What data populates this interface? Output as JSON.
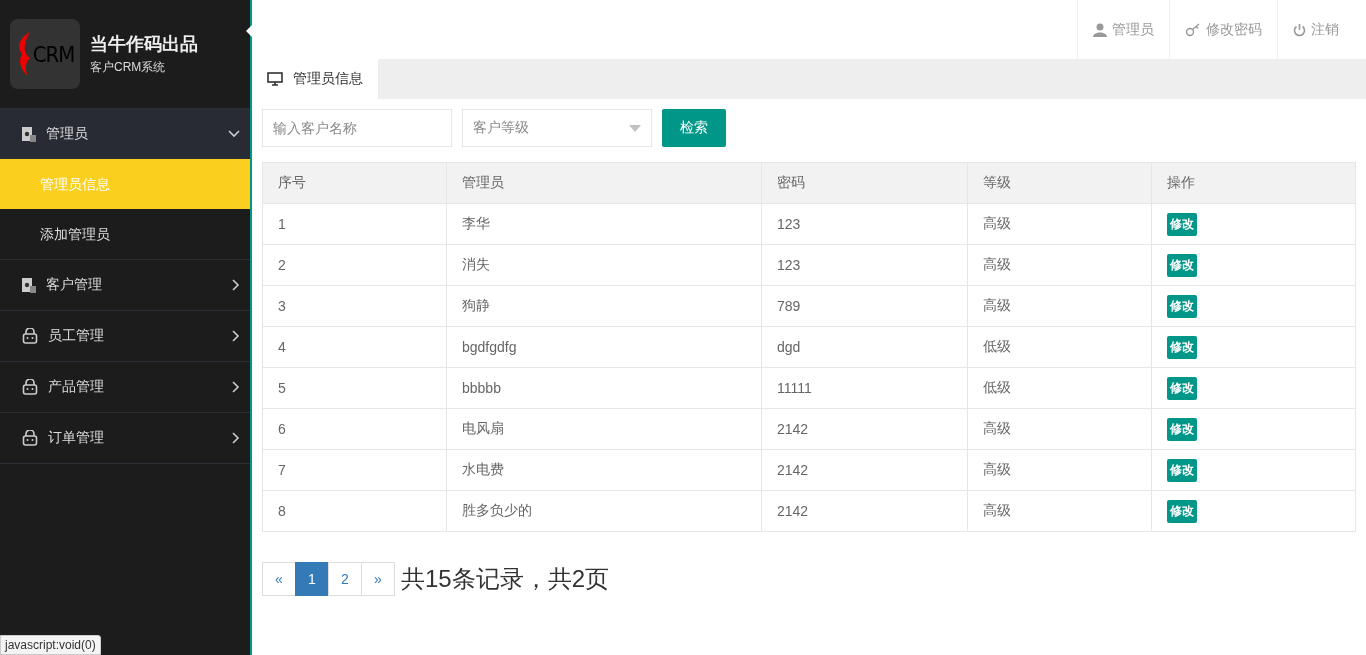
{
  "brand": {
    "logo_text": "CRM",
    "title": "当牛作码出品",
    "subtitle": "客户CRM系统"
  },
  "sidebar": {
    "items": [
      {
        "label": "管理员",
        "kind": "doc",
        "expanded": true,
        "children": [
          {
            "label": "管理员信息",
            "selected": true
          },
          {
            "label": "添加管理员",
            "selected": false
          }
        ]
      },
      {
        "label": "客户管理",
        "kind": "doc",
        "expanded": false
      },
      {
        "label": "员工管理",
        "kind": "bag",
        "expanded": false
      },
      {
        "label": "产品管理",
        "kind": "bag",
        "expanded": false
      },
      {
        "label": "订单管理",
        "kind": "bag",
        "expanded": false
      }
    ]
  },
  "header_links": [
    {
      "label": "管理员",
      "kind": "user"
    },
    {
      "label": "修改密码",
      "kind": "key"
    },
    {
      "label": "注销",
      "kind": "power"
    }
  ],
  "tabs": [
    {
      "label": "管理员信息",
      "selected": true
    }
  ],
  "search": {
    "placeholder": "输入客户名称",
    "level_select": "客户等级",
    "button": "检索"
  },
  "table": {
    "columns": [
      "序号",
      "管理员",
      "密码",
      "等级",
      "操作"
    ],
    "rows": [
      {
        "cells": [
          "1",
          "李华",
          "123",
          "高级"
        ],
        "action": "修改"
      },
      {
        "cells": [
          "2",
          "消失",
          "123",
          "高级"
        ],
        "action": "修改"
      },
      {
        "cells": [
          "3",
          "狗静",
          "789",
          "高级"
        ],
        "action": "修改"
      },
      {
        "cells": [
          "4",
          "bgdfgdfg",
          "dgd",
          "低级"
        ],
        "action": "修改"
      },
      {
        "cells": [
          "5",
          "bbbbb",
          "11111",
          "低级"
        ],
        "action": "修改"
      },
      {
        "cells": [
          "6",
          "电风扇",
          "2142",
          "高级"
        ],
        "action": "修改"
      },
      {
        "cells": [
          "7",
          "水电费",
          "2142",
          "高级"
        ],
        "action": "修改"
      },
      {
        "cells": [
          "8",
          "胜多负少的",
          "2142",
          "高级"
        ],
        "action": "修改"
      }
    ]
  },
  "pagination": {
    "prev": "«",
    "pages": [
      {
        "label": "1",
        "selected": true
      },
      {
        "label": "2",
        "selected": false
      }
    ],
    "next": "»",
    "summary": "共15条记录，共2页"
  },
  "status_bar": "javascript:void(0)"
}
